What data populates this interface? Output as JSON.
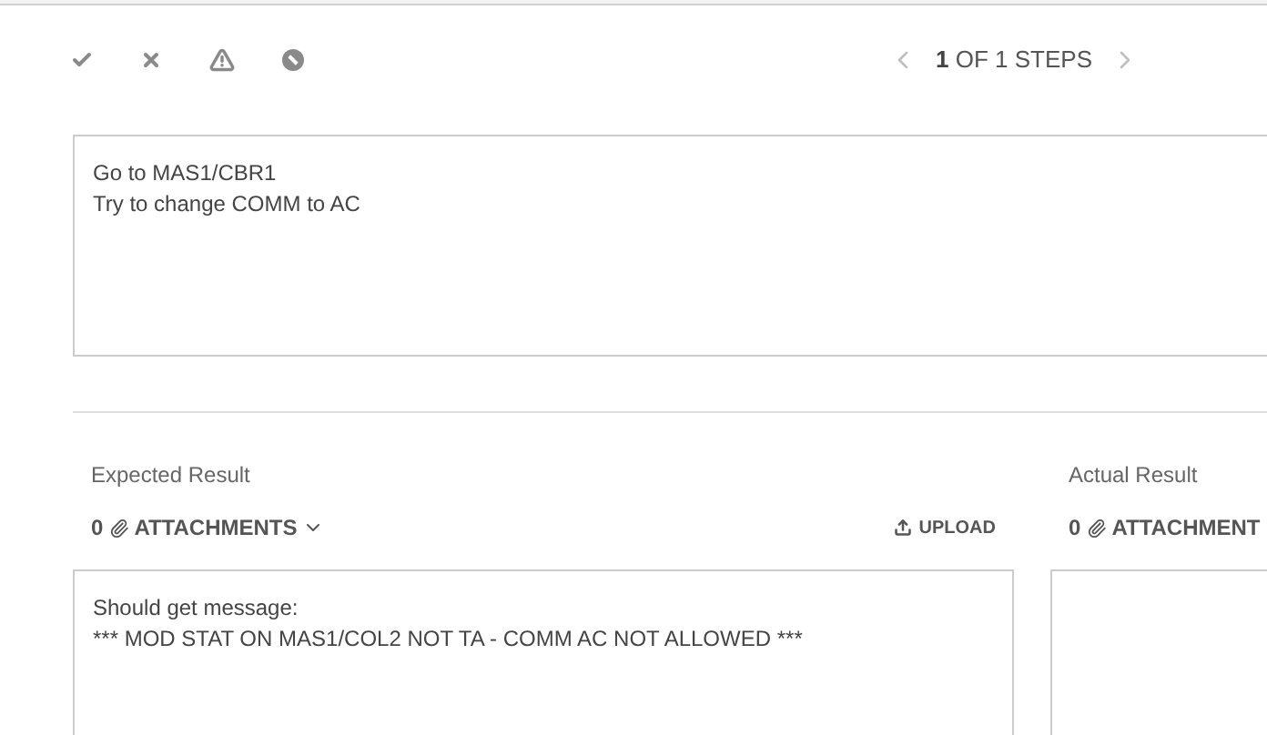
{
  "toolbar": {
    "icons": [
      {
        "kind": "pass"
      },
      {
        "kind": "fail"
      },
      {
        "kind": "warning"
      },
      {
        "kind": "blocked"
      }
    ]
  },
  "pager": {
    "current": "1",
    "rest": "OF 1 STEPS"
  },
  "step": {
    "lines": [
      "Go to MAS1/CBR1",
      "Try to change COMM to AC"
    ]
  },
  "expected": {
    "label": "Expected Result",
    "attachments_count": "0",
    "attachments_label": "ATTACHMENTS",
    "upload": "UPLOAD",
    "lines": [
      "Should get message:",
      "*** MOD STAT ON MAS1/COL2 NOT TA - COMM AC NOT ALLOWED ***"
    ]
  },
  "actual": {
    "label": "Actual Result",
    "attachments_count": "0",
    "attachments_label": "ATTACHMENT"
  }
}
